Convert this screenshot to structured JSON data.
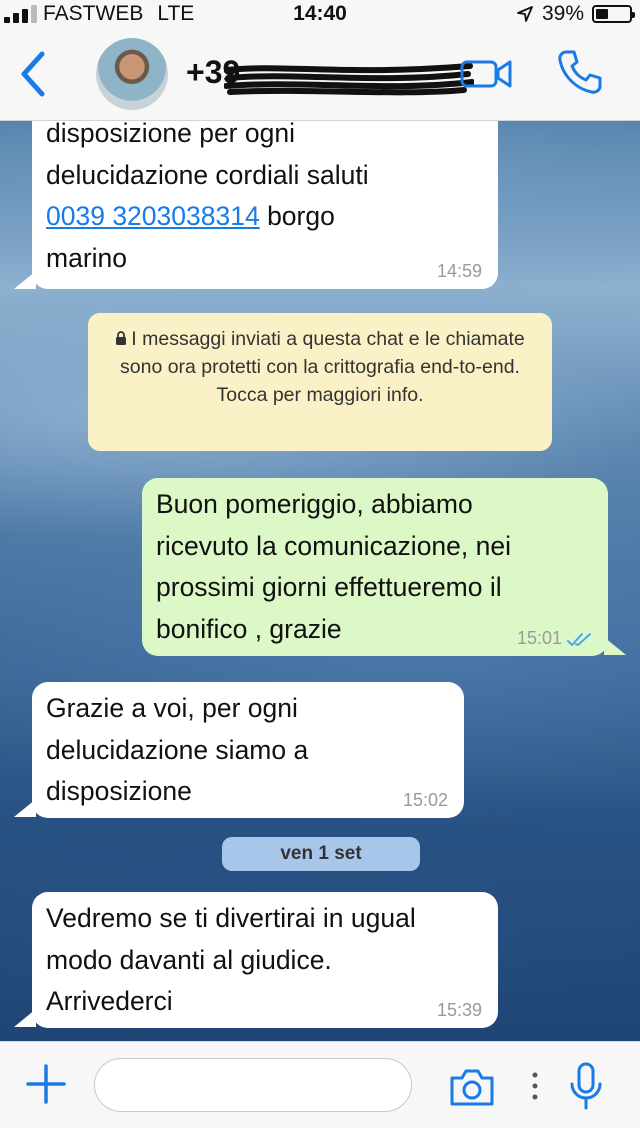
{
  "status_bar": {
    "carrier": "FASTWEB",
    "network": "LTE",
    "time": "14:40",
    "battery": "39%",
    "battery_level": 0.39
  },
  "header": {
    "contact_name": "+39",
    "contact_redacted": true
  },
  "messages": [
    {
      "direction": "incoming",
      "lines": [
        "disposizione per ogni",
        "delucidazione  cordiali saluti"
      ],
      "phone": "0039 3203038314",
      "after_phone": " borgo",
      "last_line": "marino",
      "time": "14:59"
    },
    {
      "direction": "system",
      "text": "I messaggi inviati a questa chat e le chiamate sono ora protetti con la crittografia end-to-end. Tocca per maggiori info."
    },
    {
      "direction": "outgoing",
      "lines": [
        "Buon pomeriggio, abbiamo",
        "ricevuto la comunicazione, nei",
        "prossimi giorni effettueremo il",
        "bonifico , grazie"
      ],
      "time": "15:01",
      "status": "read"
    },
    {
      "direction": "incoming",
      "lines": [
        "Grazie a voi, per ogni",
        "delucidazione siamo a",
        "disposizione"
      ],
      "time": "15:02"
    },
    {
      "direction": "date",
      "text": "ven 1 set"
    },
    {
      "direction": "incoming",
      "lines": [
        "Vedremo se ti divertirai in ugual",
        "modo davanti al giudice.",
        "Arrivederci"
      ],
      "time": "15:39"
    }
  ],
  "input_bar": {
    "placeholder": "",
    "value": ""
  },
  "colors": {
    "accent": "#1a7ae6",
    "outgoing_bubble": "#dcf8c6",
    "incoming_bubble": "#ffffff",
    "system_notice": "#fbf1c6",
    "date_chip": "#a7c6ea",
    "read_ticks": "#4fa3f7"
  },
  "icons": [
    "signal-icon",
    "location-arrow-icon",
    "battery-icon",
    "back-chevron-icon",
    "video-call-icon",
    "phone-call-icon",
    "lock-icon",
    "read-receipt-icon",
    "plus-icon",
    "camera-icon",
    "more-dots-icon",
    "microphone-icon"
  ]
}
